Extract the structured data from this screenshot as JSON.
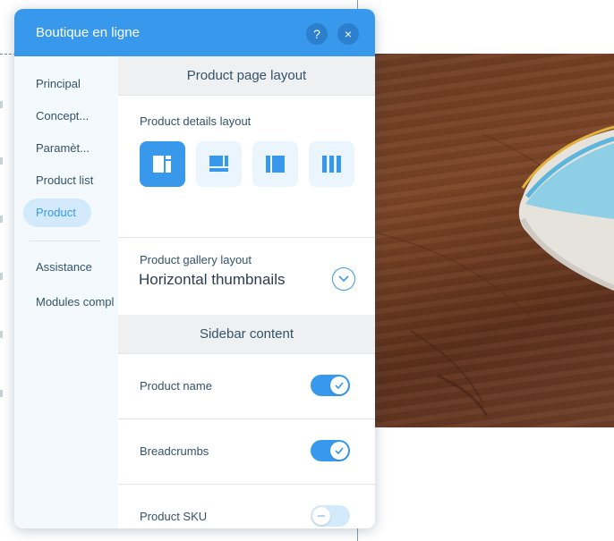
{
  "panel": {
    "title": "Boutique en ligne",
    "help_icon": "?",
    "close_icon": "×"
  },
  "sidebar": {
    "items": [
      {
        "label": "Principal"
      },
      {
        "label": "Concept..."
      },
      {
        "label": "Paramèt..."
      },
      {
        "label": "Product list"
      },
      {
        "label": "Product",
        "active": true
      },
      {
        "label": "Assistance"
      },
      {
        "label": "Modules compl"
      }
    ]
  },
  "product_page_layout": {
    "header": "Product page layout",
    "details_label": "Product details layout",
    "layouts": [
      {
        "icon": "layout-left-image-icon",
        "selected": true
      },
      {
        "icon": "layout-top-image-icon",
        "selected": false
      },
      {
        "icon": "layout-center-image-icon",
        "selected": false
      },
      {
        "icon": "layout-columns-icon",
        "selected": false
      }
    ],
    "gallery_label": "Product gallery layout",
    "gallery_value": "Horizontal thumbnails"
  },
  "sidebar_content": {
    "header": "Sidebar content",
    "toggles": [
      {
        "label": "Product name",
        "on": true
      },
      {
        "label": "Breadcrumbs",
        "on": true
      },
      {
        "label": "Product SKU",
        "on": false
      }
    ]
  },
  "colors": {
    "accent": "#3899ec",
    "text": "#32536a",
    "sidebar_bg": "#f4f9fe"
  }
}
